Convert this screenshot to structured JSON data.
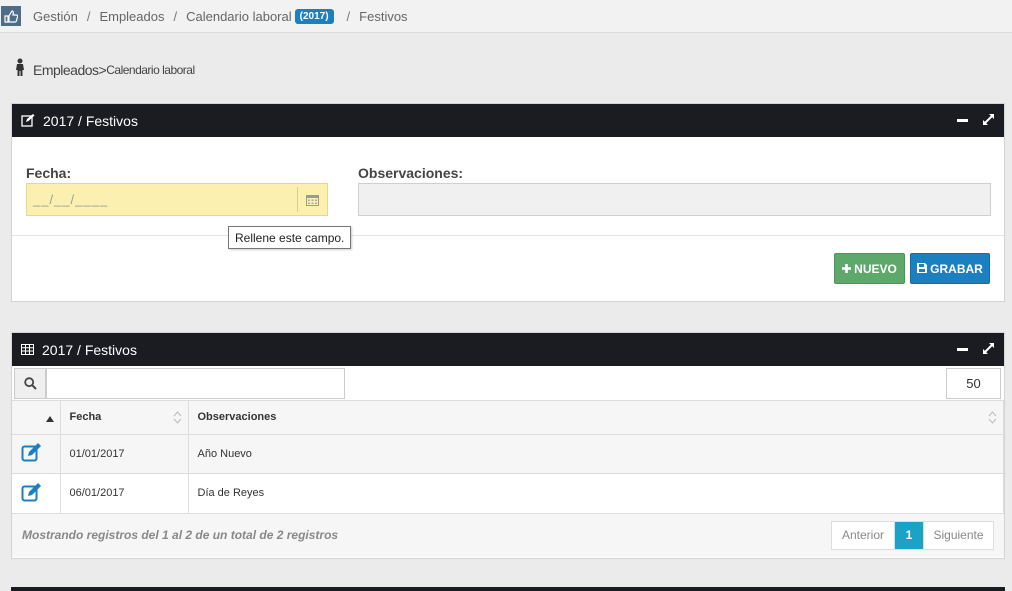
{
  "breadcrumb": {
    "items": [
      "Gestión",
      "Empleados",
      "Calendario laboral",
      "Festivos"
    ],
    "year_badge": "(2017)",
    "separator": "/"
  },
  "subtitle": {
    "section": "Empleados",
    "arrow": ">",
    "page": "Calendario laboral"
  },
  "form_panel": {
    "title": "2017 / Festivos",
    "fecha_label": "Fecha:",
    "fecha_value": "__/__/____",
    "observaciones_label": "Observaciones:",
    "observaciones_value": "",
    "tooltip": "Rellene este campo.",
    "new_button": "NUEVO",
    "save_button": "GRABAR"
  },
  "table_panel": {
    "title": "2017 / Festivos",
    "search_value": "",
    "page_size": "50",
    "columns": [
      "",
      "Fecha",
      "Observaciones"
    ],
    "rows": [
      {
        "fecha": "01/01/2017",
        "observaciones": "Año Nuevo"
      },
      {
        "fecha": "06/01/2017",
        "observaciones": "Día de Reyes"
      }
    ],
    "info": "Mostrando registros del 1 al 2 de un total de 2 registros",
    "pager": {
      "prev": "Anterior",
      "current": "1",
      "next": "Siguiente"
    }
  },
  "colors": {
    "header_dark": "#1a1c22",
    "primary": "#1c7fbf",
    "success": "#5fa86b",
    "required_field": "#fbf0b0",
    "active_page": "#1aa3c7"
  }
}
